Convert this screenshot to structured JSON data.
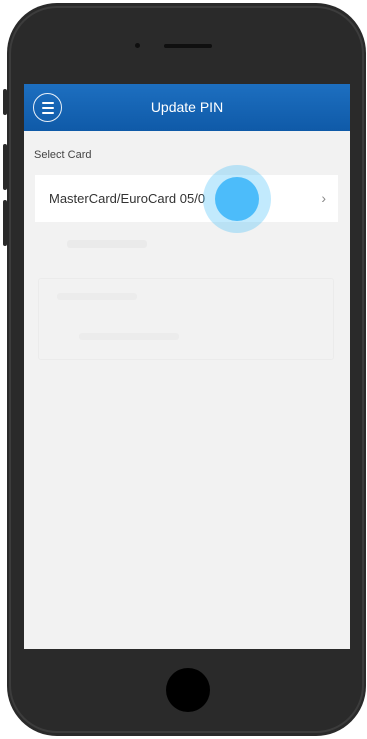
{
  "header": {
    "title": "Update PIN",
    "menu_icon": "hamburger-menu-icon"
  },
  "select_card": {
    "label": "Select Card",
    "selected_card": "MasterCard/EuroCard 05/0",
    "chevron": "›"
  },
  "colors": {
    "header_blue": "#1565b4",
    "screen_bg": "#f2f2f2",
    "touch_indicator": "#46b9fa"
  }
}
